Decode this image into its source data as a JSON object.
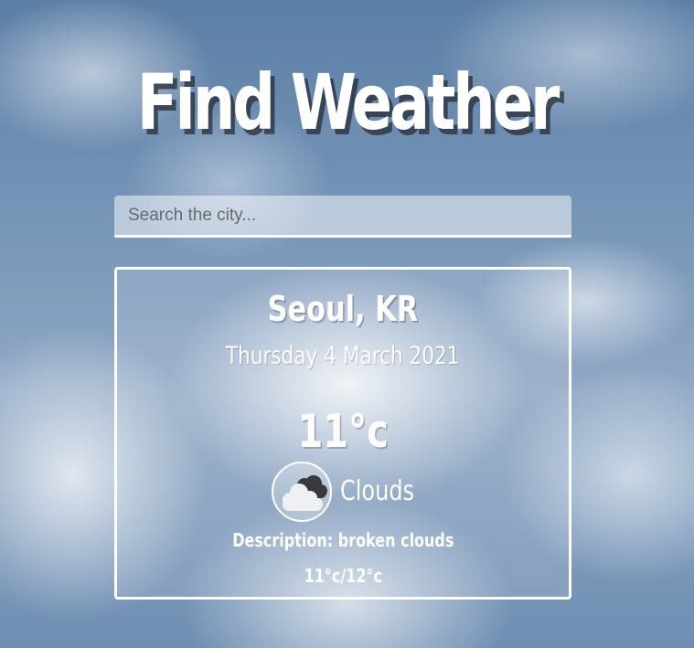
{
  "app": {
    "title": "Find Weather"
  },
  "search": {
    "placeholder": "Search the city...",
    "value": ""
  },
  "weather": {
    "location": "Seoul, KR",
    "date": "Thursday 4 March 2021",
    "temperature": "11°c",
    "condition": "Clouds",
    "condition_icon": "broken-clouds-icon",
    "description": "Description: broken clouds",
    "min_max": "11°c/12°c"
  },
  "colors": {
    "text": "#ffffff",
    "title_shadow": "#2b2f37",
    "sky": "#6f8eb2"
  }
}
